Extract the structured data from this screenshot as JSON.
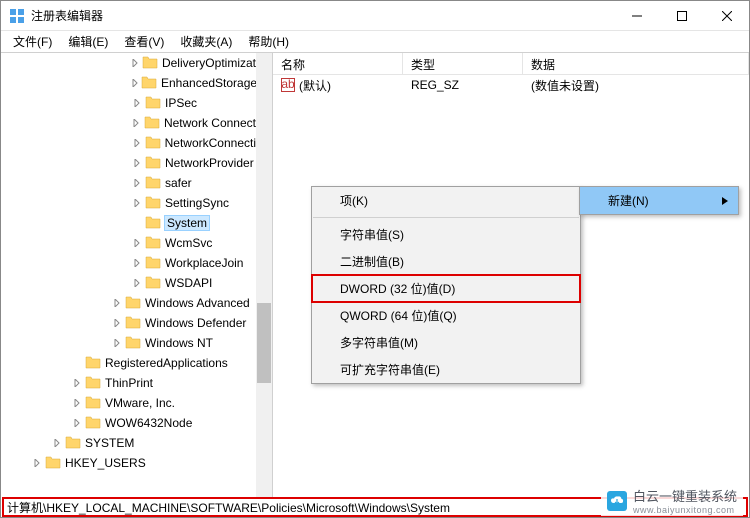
{
  "window": {
    "title": "注册表编辑器"
  },
  "menubar": {
    "file": "文件(F)",
    "edit": "编辑(E)",
    "view": "查看(V)",
    "favorites": "收藏夹(A)",
    "help": "帮助(H)"
  },
  "tree": {
    "nodes": [
      {
        "indent": 130,
        "label": "DeliveryOptimizat",
        "twisty": "closed"
      },
      {
        "indent": 130,
        "label": "EnhancedStorage",
        "twisty": "closed"
      },
      {
        "indent": 130,
        "label": "IPSec",
        "twisty": "closed"
      },
      {
        "indent": 130,
        "label": "Network Connect",
        "twisty": "closed"
      },
      {
        "indent": 130,
        "label": "NetworkConnecti",
        "twisty": "closed"
      },
      {
        "indent": 130,
        "label": "NetworkProvider",
        "twisty": "closed"
      },
      {
        "indent": 130,
        "label": "safer",
        "twisty": "closed"
      },
      {
        "indent": 130,
        "label": "SettingSync",
        "twisty": "closed"
      },
      {
        "indent": 130,
        "label": "System",
        "twisty": "none",
        "selected": true
      },
      {
        "indent": 130,
        "label": "WcmSvc",
        "twisty": "closed"
      },
      {
        "indent": 130,
        "label": "WorkplaceJoin",
        "twisty": "closed"
      },
      {
        "indent": 130,
        "label": "WSDAPI",
        "twisty": "closed"
      },
      {
        "indent": 110,
        "label": "Windows Advanced ",
        "twisty": "closed"
      },
      {
        "indent": 110,
        "label": "Windows Defender",
        "twisty": "closed"
      },
      {
        "indent": 110,
        "label": "Windows NT",
        "twisty": "closed"
      },
      {
        "indent": 70,
        "label": "RegisteredApplications",
        "twisty": "none"
      },
      {
        "indent": 70,
        "label": "ThinPrint",
        "twisty": "closed"
      },
      {
        "indent": 70,
        "label": "VMware, Inc.",
        "twisty": "closed"
      },
      {
        "indent": 70,
        "label": "WOW6432Node",
        "twisty": "closed"
      },
      {
        "indent": 50,
        "label": "SYSTEM",
        "twisty": "closed"
      },
      {
        "indent": 30,
        "label": "HKEY_USERS",
        "twisty": "closed"
      }
    ]
  },
  "list": {
    "headers": {
      "name": "名称",
      "type": "类型",
      "data": "数据"
    },
    "rows": [
      {
        "name": "(默认)",
        "type": "REG_SZ",
        "data": "(数值未设置)"
      }
    ]
  },
  "context_parent": {
    "new": "新建(N)"
  },
  "context_sub": {
    "key": "项(K)",
    "string": "字符串值(S)",
    "binary": "二进制值(B)",
    "dword": "DWORD (32 位)值(D)",
    "qword": "QWORD (64 位)值(Q)",
    "multi": "多字符串值(M)",
    "expand": "可扩充字符串值(E)"
  },
  "status": {
    "path": "计算机\\HKEY_LOCAL_MACHINE\\SOFTWARE\\Policies\\Microsoft\\Windows\\System"
  },
  "watermark": {
    "cn": "白云一键重装系统",
    "en": "www.baiyunxitong.com"
  }
}
